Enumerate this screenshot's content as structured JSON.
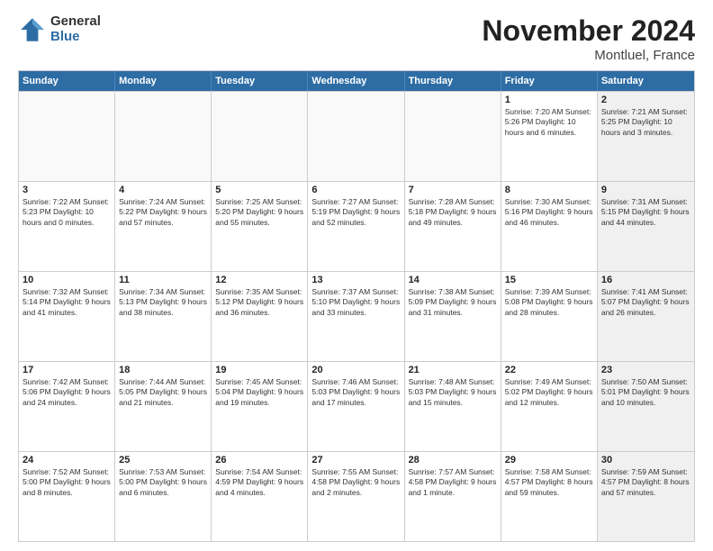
{
  "logo": {
    "general": "General",
    "blue": "Blue"
  },
  "title": {
    "month": "November 2024",
    "location": "Montluel, France"
  },
  "header": {
    "days": [
      "Sunday",
      "Monday",
      "Tuesday",
      "Wednesday",
      "Thursday",
      "Friday",
      "Saturday"
    ]
  },
  "weeks": [
    [
      {
        "day": "",
        "info": ""
      },
      {
        "day": "",
        "info": ""
      },
      {
        "day": "",
        "info": ""
      },
      {
        "day": "",
        "info": ""
      },
      {
        "day": "",
        "info": ""
      },
      {
        "day": "1",
        "info": "Sunrise: 7:20 AM\nSunset: 5:26 PM\nDaylight: 10 hours\nand 6 minutes."
      },
      {
        "day": "2",
        "info": "Sunrise: 7:21 AM\nSunset: 5:25 PM\nDaylight: 10 hours\nand 3 minutes."
      }
    ],
    [
      {
        "day": "3",
        "info": "Sunrise: 7:22 AM\nSunset: 5:23 PM\nDaylight: 10 hours\nand 0 minutes."
      },
      {
        "day": "4",
        "info": "Sunrise: 7:24 AM\nSunset: 5:22 PM\nDaylight: 9 hours\nand 57 minutes."
      },
      {
        "day": "5",
        "info": "Sunrise: 7:25 AM\nSunset: 5:20 PM\nDaylight: 9 hours\nand 55 minutes."
      },
      {
        "day": "6",
        "info": "Sunrise: 7:27 AM\nSunset: 5:19 PM\nDaylight: 9 hours\nand 52 minutes."
      },
      {
        "day": "7",
        "info": "Sunrise: 7:28 AM\nSunset: 5:18 PM\nDaylight: 9 hours\nand 49 minutes."
      },
      {
        "day": "8",
        "info": "Sunrise: 7:30 AM\nSunset: 5:16 PM\nDaylight: 9 hours\nand 46 minutes."
      },
      {
        "day": "9",
        "info": "Sunrise: 7:31 AM\nSunset: 5:15 PM\nDaylight: 9 hours\nand 44 minutes."
      }
    ],
    [
      {
        "day": "10",
        "info": "Sunrise: 7:32 AM\nSunset: 5:14 PM\nDaylight: 9 hours\nand 41 minutes."
      },
      {
        "day": "11",
        "info": "Sunrise: 7:34 AM\nSunset: 5:13 PM\nDaylight: 9 hours\nand 38 minutes."
      },
      {
        "day": "12",
        "info": "Sunrise: 7:35 AM\nSunset: 5:12 PM\nDaylight: 9 hours\nand 36 minutes."
      },
      {
        "day": "13",
        "info": "Sunrise: 7:37 AM\nSunset: 5:10 PM\nDaylight: 9 hours\nand 33 minutes."
      },
      {
        "day": "14",
        "info": "Sunrise: 7:38 AM\nSunset: 5:09 PM\nDaylight: 9 hours\nand 31 minutes."
      },
      {
        "day": "15",
        "info": "Sunrise: 7:39 AM\nSunset: 5:08 PM\nDaylight: 9 hours\nand 28 minutes."
      },
      {
        "day": "16",
        "info": "Sunrise: 7:41 AM\nSunset: 5:07 PM\nDaylight: 9 hours\nand 26 minutes."
      }
    ],
    [
      {
        "day": "17",
        "info": "Sunrise: 7:42 AM\nSunset: 5:06 PM\nDaylight: 9 hours\nand 24 minutes."
      },
      {
        "day": "18",
        "info": "Sunrise: 7:44 AM\nSunset: 5:05 PM\nDaylight: 9 hours\nand 21 minutes."
      },
      {
        "day": "19",
        "info": "Sunrise: 7:45 AM\nSunset: 5:04 PM\nDaylight: 9 hours\nand 19 minutes."
      },
      {
        "day": "20",
        "info": "Sunrise: 7:46 AM\nSunset: 5:03 PM\nDaylight: 9 hours\nand 17 minutes."
      },
      {
        "day": "21",
        "info": "Sunrise: 7:48 AM\nSunset: 5:03 PM\nDaylight: 9 hours\nand 15 minutes."
      },
      {
        "day": "22",
        "info": "Sunrise: 7:49 AM\nSunset: 5:02 PM\nDaylight: 9 hours\nand 12 minutes."
      },
      {
        "day": "23",
        "info": "Sunrise: 7:50 AM\nSunset: 5:01 PM\nDaylight: 9 hours\nand 10 minutes."
      }
    ],
    [
      {
        "day": "24",
        "info": "Sunrise: 7:52 AM\nSunset: 5:00 PM\nDaylight: 9 hours\nand 8 minutes."
      },
      {
        "day": "25",
        "info": "Sunrise: 7:53 AM\nSunset: 5:00 PM\nDaylight: 9 hours\nand 6 minutes."
      },
      {
        "day": "26",
        "info": "Sunrise: 7:54 AM\nSunset: 4:59 PM\nDaylight: 9 hours\nand 4 minutes."
      },
      {
        "day": "27",
        "info": "Sunrise: 7:55 AM\nSunset: 4:58 PM\nDaylight: 9 hours\nand 2 minutes."
      },
      {
        "day": "28",
        "info": "Sunrise: 7:57 AM\nSunset: 4:58 PM\nDaylight: 9 hours\nand 1 minute."
      },
      {
        "day": "29",
        "info": "Sunrise: 7:58 AM\nSunset: 4:57 PM\nDaylight: 8 hours\nand 59 minutes."
      },
      {
        "day": "30",
        "info": "Sunrise: 7:59 AM\nSunset: 4:57 PM\nDaylight: 8 hours\nand 57 minutes."
      }
    ]
  ]
}
